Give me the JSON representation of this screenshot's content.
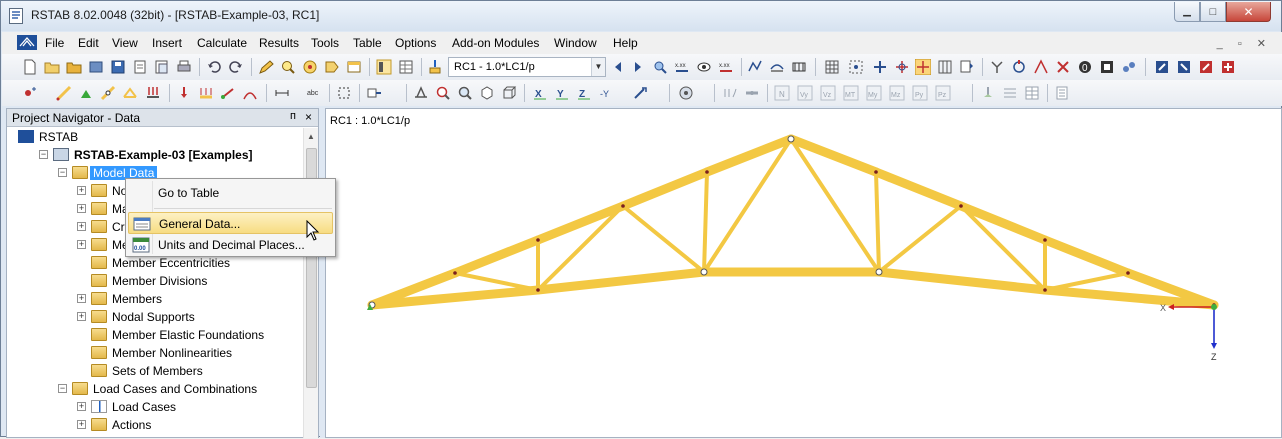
{
  "window": {
    "title": "RSTAB 8.02.0048 (32bit) - [RSTAB-Example-03, RC1]",
    "min_glyph": "▁",
    "max_glyph": "□",
    "close_glyph": "✕"
  },
  "menu": {
    "items": [
      "File",
      "Edit",
      "View",
      "Insert",
      "Calculate",
      "Results",
      "Tools",
      "Table",
      "Options",
      "Add-on Modules",
      "Window",
      "Help"
    ],
    "mdi_controls": "_ ▫ ✕"
  },
  "toolbar": {
    "load_case_combo": "RC1 - 1.0*LC1/p",
    "toolbar2_labels": [
      "N",
      "Vy",
      "Vz",
      "MT",
      "My",
      "Mz",
      "Py",
      "Pz"
    ]
  },
  "navigator": {
    "title": "Project Navigator - Data",
    "pin_glyph": "ᴨ",
    "close_glyph": "×",
    "tree": [
      {
        "label": "RSTAB",
        "level": 0,
        "expander": "",
        "icon": "rstab-icon"
      },
      {
        "label": "RSTAB-Example-03 [Examples]",
        "level": 1,
        "expander": "−",
        "icon": "model-icon",
        "bold": true
      },
      {
        "label": "Model Data",
        "level": 2,
        "expander": "−",
        "icon": "folder-icon",
        "selected": true
      },
      {
        "label": "Nodes",
        "level": 3,
        "expander": "+",
        "icon": "folder-icon"
      },
      {
        "label": "Materials",
        "level": 3,
        "expander": "+",
        "icon": "folder-icon"
      },
      {
        "label": "Cross-Sections",
        "level": 3,
        "expander": "+",
        "icon": "folder-icon"
      },
      {
        "label": "Member Hinges",
        "level": 3,
        "expander": "+",
        "icon": "folder-icon"
      },
      {
        "label": "Member Eccentricities",
        "level": 3,
        "expander": "",
        "icon": "folder-icon"
      },
      {
        "label": "Member Divisions",
        "level": 3,
        "expander": "",
        "icon": "folder-icon"
      },
      {
        "label": "Members",
        "level": 3,
        "expander": "+",
        "icon": "folder-icon"
      },
      {
        "label": "Nodal Supports",
        "level": 3,
        "expander": "+",
        "icon": "folder-icon"
      },
      {
        "label": "Member Elastic Foundations",
        "level": 3,
        "expander": "",
        "icon": "folder-icon"
      },
      {
        "label": "Member Nonlinearities",
        "level": 3,
        "expander": "",
        "icon": "folder-icon"
      },
      {
        "label": "Sets of Members",
        "level": 3,
        "expander": "",
        "icon": "folder-icon"
      },
      {
        "label": "Load Cases and Combinations",
        "level": 2,
        "expander": "−",
        "icon": "folder-icon"
      },
      {
        "label": "Load Cases",
        "level": 3,
        "expander": "+",
        "icon": "load-case-icon"
      },
      {
        "label": "Actions",
        "level": 3,
        "expander": "+",
        "icon": "folder-icon"
      }
    ]
  },
  "context_menu": {
    "go_to_table": "Go to Table",
    "general_data": "General Data...",
    "units": "Units and Decimal Places...",
    "units_icon_text": "0.00"
  },
  "graphics": {
    "caption": "RC1 : 1.0*LC1/p",
    "axis_x_label": "X",
    "axis_z_label": "Z",
    "member_color": "#f3c843",
    "member_edge_color": "#d9a91f",
    "axis_x_color": "#cc2020",
    "axis_z_color": "#2030cc"
  }
}
